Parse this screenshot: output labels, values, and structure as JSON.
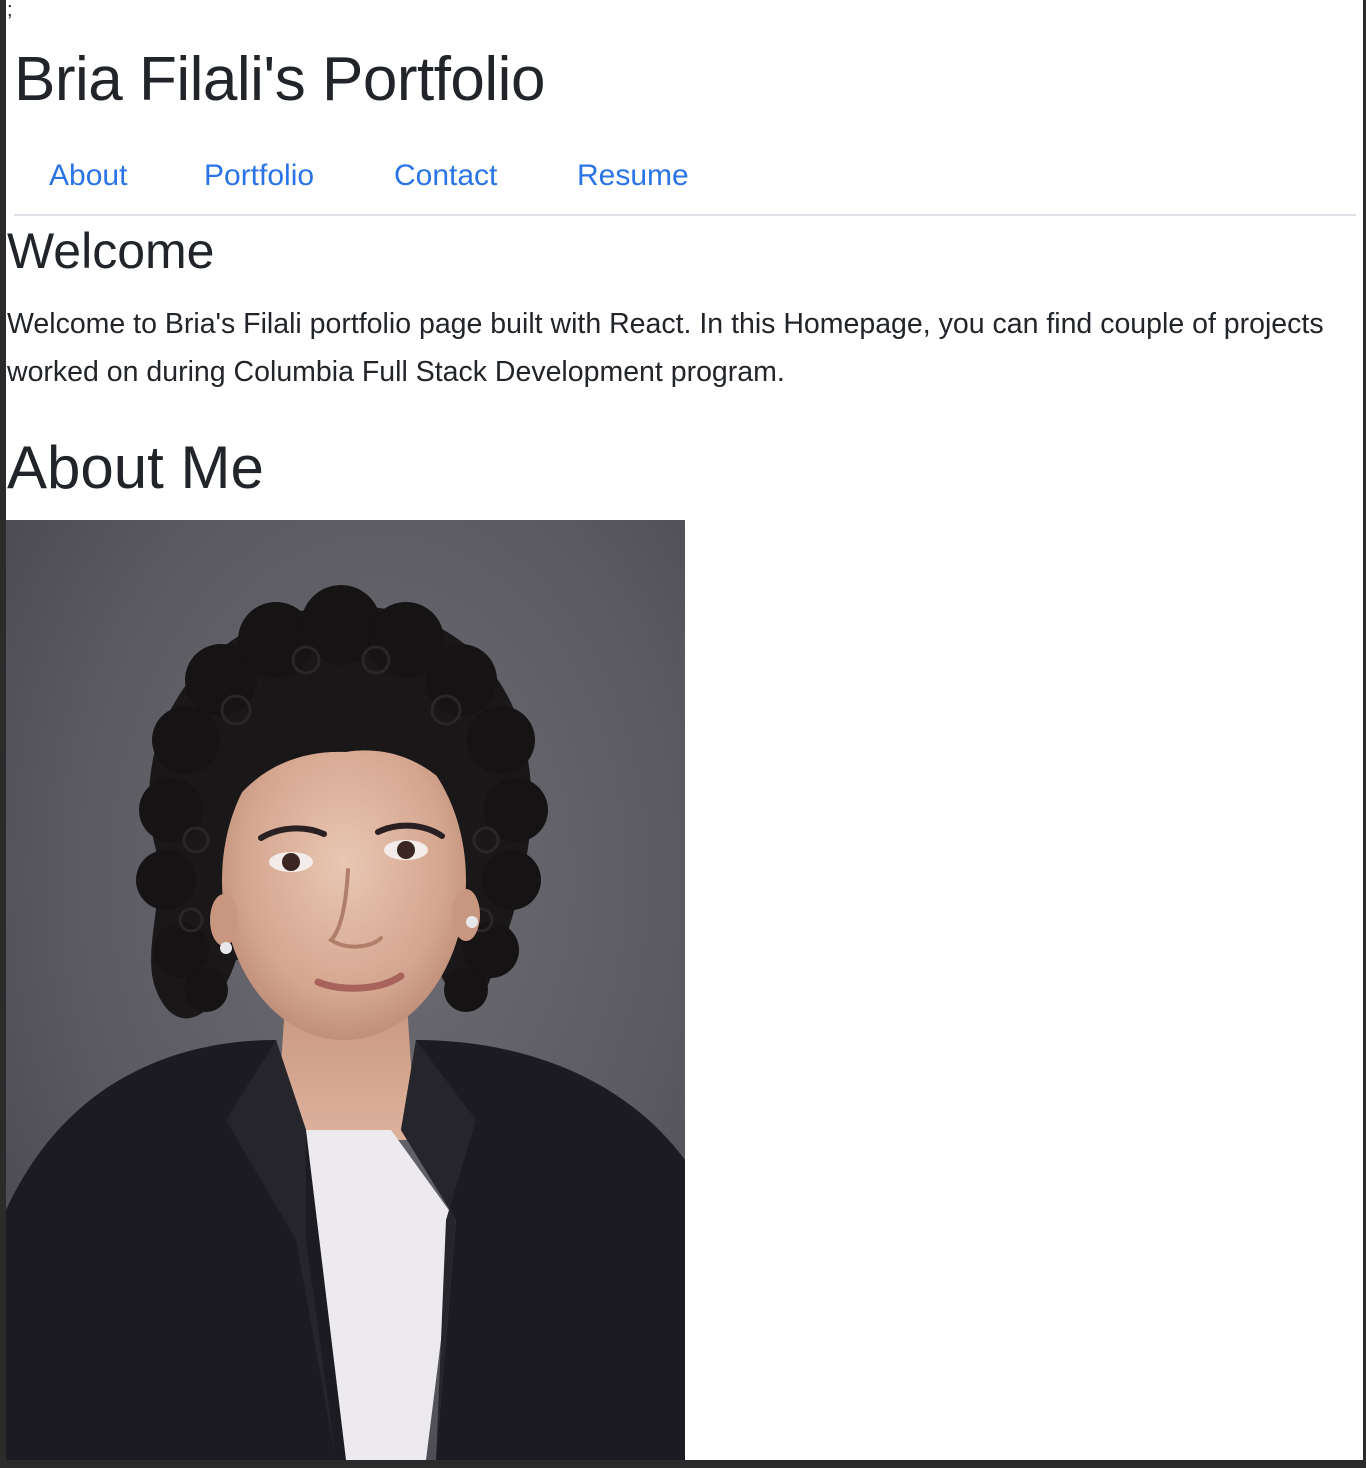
{
  "stray_text": ";",
  "header": {
    "title": "Bria Filali's Portfolio"
  },
  "nav": {
    "items": [
      {
        "label": "About"
      },
      {
        "label": "Portfolio"
      },
      {
        "label": "Contact"
      },
      {
        "label": "Resume"
      }
    ]
  },
  "welcome": {
    "heading": "Welcome",
    "text": "Welcome to Bria's Filali portfolio page built with React. In this Homepage, you can find couple of projects worked on during Columbia Full Stack Development program."
  },
  "about": {
    "heading": "About Me"
  },
  "colors": {
    "link": "#2a74e8",
    "text": "#212529",
    "divider": "#dee2e6",
    "photo_background": "#5d5c63"
  }
}
